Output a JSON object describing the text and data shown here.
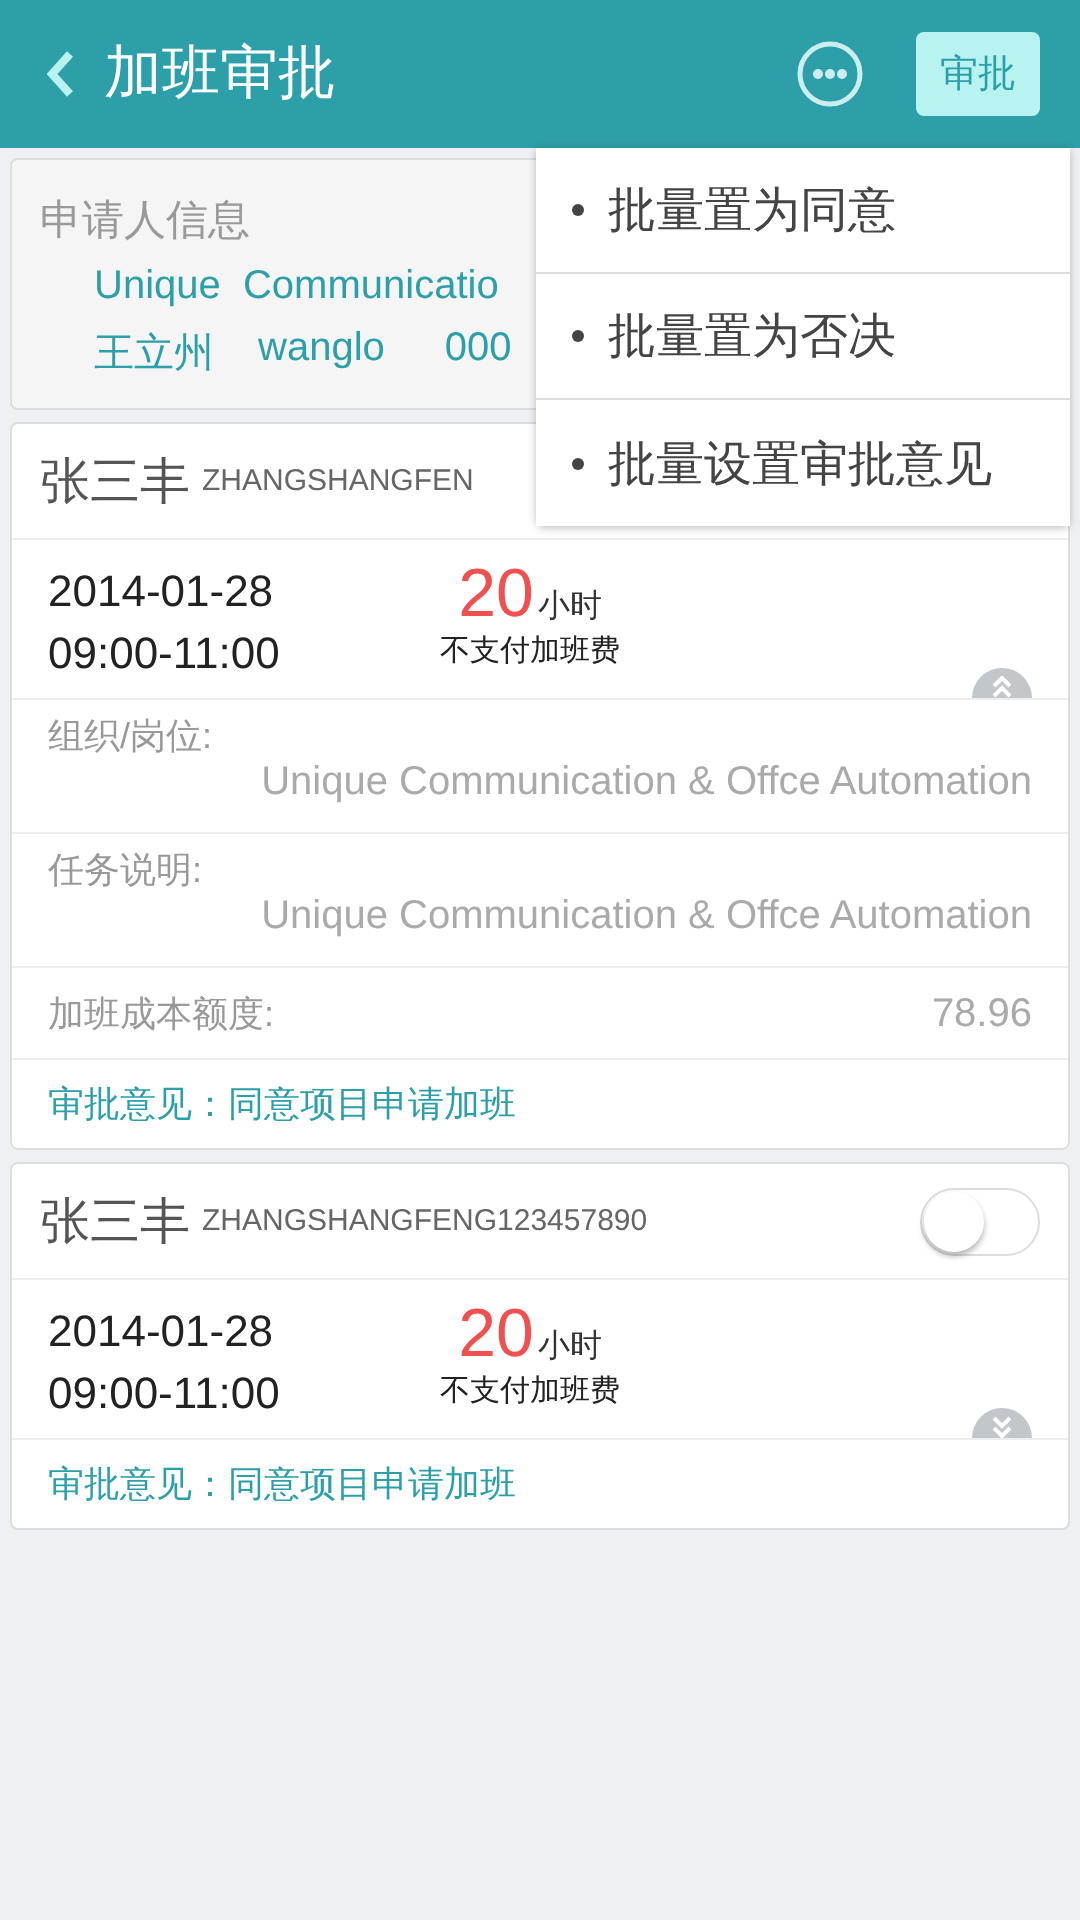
{
  "header": {
    "title": "加班审批",
    "action": "审批"
  },
  "applicant": {
    "title": "申请人信息",
    "company": "Unique  Communicatio",
    "name": "王立州",
    "account": "wanglo",
    "code": "000"
  },
  "requests": [
    {
      "name": "张三丰",
      "id": "ZHANGSHANGFEN",
      "date": "2014-01-28",
      "time": "09:00-11:00",
      "hours": "20",
      "unit": "小时",
      "pay_note": "不支付加班费",
      "expanded": true,
      "details": [
        {
          "kind": "stacked",
          "field": "组织/岗位:",
          "content": "Unique Communication & Offce Automation"
        },
        {
          "kind": "stacked",
          "field": "任务说明:",
          "content": "Unique Communication & Offce Automation"
        },
        {
          "kind": "inline",
          "field": "加班成本额度:",
          "content": "78.96"
        }
      ],
      "opinion": "审批意见：同意项目申请加班"
    },
    {
      "name": "张三丰",
      "id": "ZHANGSHANGFENG123457890",
      "switch_on": false,
      "date": "2014-01-28",
      "time": "09:00-11:00",
      "hours": "20",
      "unit": "小时",
      "pay_note": "不支付加班费",
      "expanded": false,
      "opinion": "审批意见：同意项目申请加班"
    }
  ],
  "menu": {
    "items": [
      "批量置为同意",
      "批量置为否决",
      "批量设置审批意见"
    ]
  }
}
